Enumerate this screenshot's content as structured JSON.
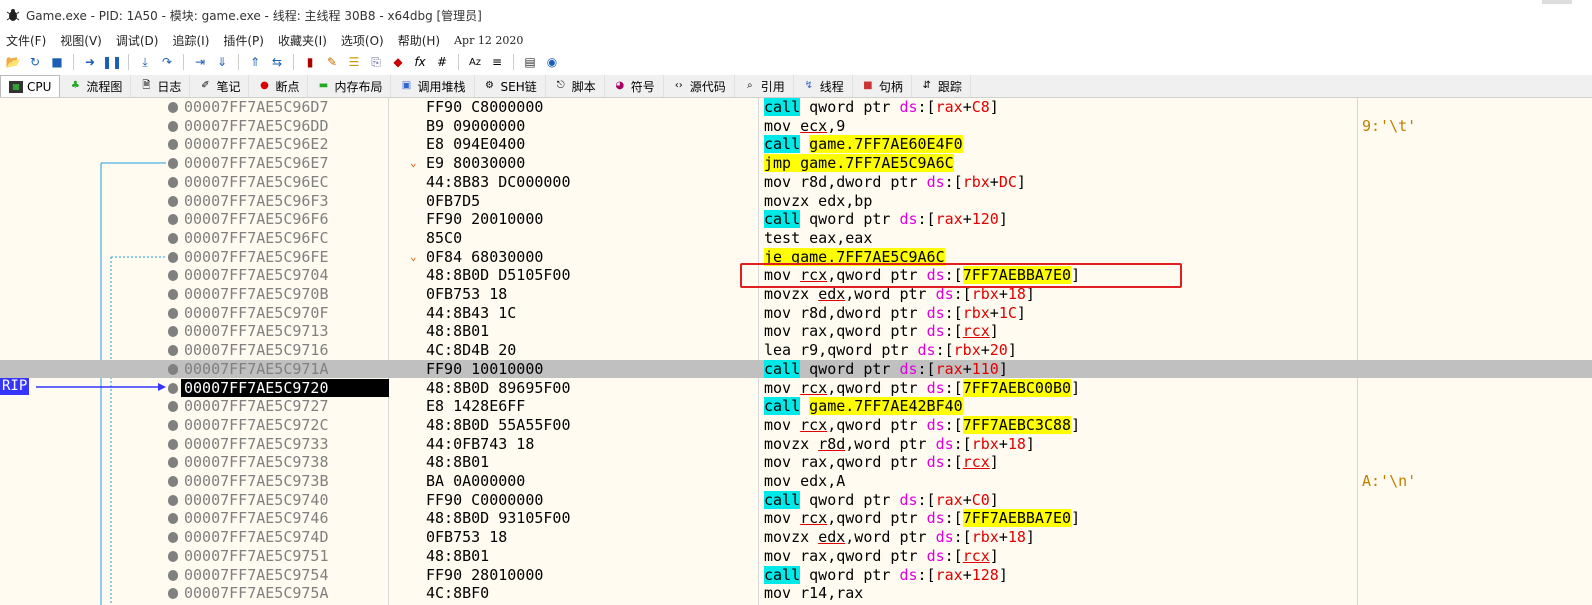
{
  "window": {
    "title": "Game.exe - PID: 1A50 - 模块: game.exe - 线程: 主线程 30B8 - x64dbg [管理员]"
  },
  "menu": {
    "items": [
      "文件(F)",
      "视图(V)",
      "调试(D)",
      "追踪(I)",
      "插件(P)",
      "收藏夹(I)",
      "选项(O)",
      "帮助(H)"
    ],
    "date": "Apr 12 2020"
  },
  "toolbar": {
    "icons": [
      "open-icon",
      "restart-icon",
      "stop-icon",
      "run-icon",
      "pause-icon",
      "step-into-icon",
      "step-over-icon",
      "trace-into-icon",
      "trace-over-icon",
      "execute-till-return-icon",
      "run-to-user-code-icon",
      "highlight-icon",
      "comment-icon",
      "label-icon",
      "bookmark-icon",
      "function-icon",
      "strings-icon",
      "patch-icon",
      "hash-icon",
      "font-icon",
      "calculator-icon",
      "about-icon"
    ],
    "fx_label": "fx",
    "hash_label": "#"
  },
  "tabs": [
    {
      "label": "CPU",
      "active": true,
      "icon": "cpu-icon"
    },
    {
      "label": "流程图",
      "icon": "graph-icon"
    },
    {
      "label": "日志",
      "icon": "log-icon"
    },
    {
      "label": "笔记",
      "icon": "notes-icon"
    },
    {
      "label": "断点",
      "icon": "breakpoint-icon"
    },
    {
      "label": "内存布局",
      "icon": "memory-icon"
    },
    {
      "label": "调用堆栈",
      "icon": "callstack-icon"
    },
    {
      "label": "SEH链",
      "icon": "seh-icon"
    },
    {
      "label": "脚本",
      "icon": "script-icon"
    },
    {
      "label": "符号",
      "icon": "symbol-icon"
    },
    {
      "label": "源代码",
      "icon": "source-icon"
    },
    {
      "label": "引用",
      "icon": "references-icon"
    },
    {
      "label": "线程",
      "icon": "threads-icon"
    },
    {
      "label": "句柄",
      "icon": "handles-icon"
    },
    {
      "label": "跟踪",
      "icon": "trace-icon"
    }
  ],
  "rip_label": "RIP",
  "rows": [
    {
      "addr": "00007FF7AE5C96D7",
      "bytes": "FF90 C8000000",
      "asm": [
        [
          "call",
          "call"
        ],
        [
          "t",
          " qword ptr "
        ],
        [
          "mag",
          "ds"
        ],
        [
          "t",
          ":["
        ],
        [
          "red",
          "rax"
        ],
        [
          "t",
          "+"
        ],
        [
          "red",
          "C8"
        ],
        [
          "t",
          "]"
        ]
      ],
      "cmt": ""
    },
    {
      "addr": "00007FF7AE5C96DD",
      "bytes": "B9 09000000",
      "asm": [
        [
          "t",
          "mov "
        ],
        [
          "reg",
          "ecx"
        ],
        [
          "t",
          ",9"
        ]
      ],
      "cmt": "9:'\\t'"
    },
    {
      "addr": "00007FF7AE5C96E2",
      "bytes": "E8 094E0400",
      "asm": [
        [
          "call",
          "call"
        ],
        [
          "t",
          " "
        ],
        [
          "yel",
          "game.7FF7AE60E4F0"
        ]
      ],
      "cmt": ""
    },
    {
      "addr": "00007FF7AE5C96E7",
      "bytes": "E9 80030000",
      "jarrow": true,
      "asm": [
        [
          "yel",
          "jmp game.7FF7AE5C9A6C"
        ]
      ],
      "cmt": ""
    },
    {
      "addr": "00007FF7AE5C96EC",
      "bytes": "44:8B83 DC000000",
      "asm": [
        [
          "t",
          "mov r8d,dword ptr "
        ],
        [
          "mag",
          "ds"
        ],
        [
          "t",
          ":["
        ],
        [
          "red",
          "rbx"
        ],
        [
          "t",
          "+"
        ],
        [
          "red",
          "DC"
        ],
        [
          "t",
          "]"
        ]
      ],
      "cmt": ""
    },
    {
      "addr": "00007FF7AE5C96F3",
      "bytes": "0FB7D5",
      "asm": [
        [
          "t",
          "movzx edx,bp"
        ]
      ],
      "cmt": ""
    },
    {
      "addr": "00007FF7AE5C96F6",
      "bytes": "FF90 20010000",
      "asm": [
        [
          "call",
          "call"
        ],
        [
          "t",
          " qword ptr "
        ],
        [
          "mag",
          "ds"
        ],
        [
          "t",
          ":["
        ],
        [
          "red",
          "rax"
        ],
        [
          "t",
          "+"
        ],
        [
          "red",
          "120"
        ],
        [
          "t",
          "]"
        ]
      ],
      "cmt": ""
    },
    {
      "addr": "00007FF7AE5C96FC",
      "bytes": "85C0",
      "asm": [
        [
          "t",
          "test eax,eax"
        ]
      ],
      "cmt": ""
    },
    {
      "addr": "00007FF7AE5C96FE",
      "bytes": "0F84 68030000",
      "jarrow": true,
      "asm": [
        [
          "yel",
          "je game.7FF7AE5C9A6C"
        ]
      ],
      "cmt": ""
    },
    {
      "addr": "00007FF7AE5C9704",
      "bytes": "48:8B0D D5105F00",
      "asm": [
        [
          "t",
          "mov "
        ],
        [
          "reg",
          "rcx"
        ],
        [
          "t",
          ",qword ptr "
        ],
        [
          "mag",
          "ds"
        ],
        [
          "t",
          ":["
        ],
        [
          "yel",
          "7FF7AEBBA7E0"
        ],
        [
          "t",
          "]"
        ]
      ],
      "cmt": ""
    },
    {
      "addr": "00007FF7AE5C970B",
      "bytes": "0FB753 18",
      "asm": [
        [
          "t",
          "movzx "
        ],
        [
          "reg",
          "edx"
        ],
        [
          "t",
          ",word ptr "
        ],
        [
          "mag",
          "ds"
        ],
        [
          "t",
          ":["
        ],
        [
          "red",
          "rbx"
        ],
        [
          "t",
          "+"
        ],
        [
          "red",
          "18"
        ],
        [
          "t",
          "]"
        ]
      ],
      "cmt": ""
    },
    {
      "addr": "00007FF7AE5C970F",
      "bytes": "44:8B43 1C",
      "asm": [
        [
          "t",
          "mov r8d,dword ptr "
        ],
        [
          "mag",
          "ds"
        ],
        [
          "t",
          ":["
        ],
        [
          "red",
          "rbx"
        ],
        [
          "t",
          "+"
        ],
        [
          "red",
          "1C"
        ],
        [
          "t",
          "]"
        ]
      ],
      "cmt": ""
    },
    {
      "addr": "00007FF7AE5C9713",
      "bytes": "48:8B01",
      "asm": [
        [
          "t",
          "mov rax,qword ptr "
        ],
        [
          "mag",
          "ds"
        ],
        [
          "t",
          ":["
        ],
        [
          "redu",
          "rcx"
        ],
        [
          "t",
          "]"
        ]
      ],
      "cmt": ""
    },
    {
      "addr": "00007FF7AE5C9716",
      "bytes": "4C:8D4B 20",
      "asm": [
        [
          "t",
          "lea r9,qword ptr "
        ],
        [
          "mag",
          "ds"
        ],
        [
          "t",
          ":["
        ],
        [
          "red",
          "rbx"
        ],
        [
          "t",
          "+"
        ],
        [
          "red",
          "20"
        ],
        [
          "t",
          "]"
        ]
      ],
      "cmt": ""
    },
    {
      "addr": "00007FF7AE5C971A",
      "bytes": "FF90 10010000",
      "sel": true,
      "asm": [
        [
          "call",
          "call"
        ],
        [
          "t",
          " qword ptr "
        ],
        [
          "mag",
          "ds"
        ],
        [
          "t",
          ":["
        ],
        [
          "red",
          "rax"
        ],
        [
          "t",
          "+"
        ],
        [
          "red",
          "110"
        ],
        [
          "t",
          "]"
        ]
      ],
      "cmt": ""
    },
    {
      "addr": "00007FF7AE5C9720",
      "bytes": "48:8B0D 89695F00",
      "cur": true,
      "asm": [
        [
          "t",
          "mov "
        ],
        [
          "reg",
          "rcx"
        ],
        [
          "t",
          ",qword ptr "
        ],
        [
          "mag",
          "ds"
        ],
        [
          "t",
          ":["
        ],
        [
          "yel",
          "7FF7AEBC00B0"
        ],
        [
          "t",
          "]"
        ]
      ],
      "cmt": ""
    },
    {
      "addr": "00007FF7AE5C9727",
      "bytes": "E8 1428E6FF",
      "asm": [
        [
          "call",
          "call"
        ],
        [
          "t",
          " "
        ],
        [
          "yel",
          "game.7FF7AE42BF40"
        ]
      ],
      "cmt": ""
    },
    {
      "addr": "00007FF7AE5C972C",
      "bytes": "48:8B0D 55A55F00",
      "asm": [
        [
          "t",
          "mov "
        ],
        [
          "reg",
          "rcx"
        ],
        [
          "t",
          ",qword ptr "
        ],
        [
          "mag",
          "ds"
        ],
        [
          "t",
          ":["
        ],
        [
          "yel",
          "7FF7AEBC3C88"
        ],
        [
          "t",
          "]"
        ]
      ],
      "cmt": ""
    },
    {
      "addr": "00007FF7AE5C9733",
      "bytes": "44:0FB743 18",
      "asm": [
        [
          "t",
          "movzx "
        ],
        [
          "reg",
          "r8d"
        ],
        [
          "t",
          ",word ptr "
        ],
        [
          "mag",
          "ds"
        ],
        [
          "t",
          ":["
        ],
        [
          "red",
          "rbx"
        ],
        [
          "t",
          "+"
        ],
        [
          "red",
          "18"
        ],
        [
          "t",
          "]"
        ]
      ],
      "cmt": ""
    },
    {
      "addr": "00007FF7AE5C9738",
      "bytes": "48:8B01",
      "asm": [
        [
          "t",
          "mov rax,qword ptr "
        ],
        [
          "mag",
          "ds"
        ],
        [
          "t",
          ":["
        ],
        [
          "redu",
          "rcx"
        ],
        [
          "t",
          "]"
        ]
      ],
      "cmt": ""
    },
    {
      "addr": "00007FF7AE5C973B",
      "bytes": "BA 0A000000",
      "asm": [
        [
          "t",
          "mov edx,A"
        ]
      ],
      "cmt": "A:'\\n'"
    },
    {
      "addr": "00007FF7AE5C9740",
      "bytes": "FF90 C0000000",
      "asm": [
        [
          "call",
          "call"
        ],
        [
          "t",
          " qword ptr "
        ],
        [
          "mag",
          "ds"
        ],
        [
          "t",
          ":["
        ],
        [
          "red",
          "rax"
        ],
        [
          "t",
          "+"
        ],
        [
          "red",
          "C0"
        ],
        [
          "t",
          "]"
        ]
      ],
      "cmt": ""
    },
    {
      "addr": "00007FF7AE5C9746",
      "bytes": "48:8B0D 93105F00",
      "asm": [
        [
          "t",
          "mov "
        ],
        [
          "reg",
          "rcx"
        ],
        [
          "t",
          ",qword ptr "
        ],
        [
          "mag",
          "ds"
        ],
        [
          "t",
          ":["
        ],
        [
          "yel",
          "7FF7AEBBA7E0"
        ],
        [
          "t",
          "]"
        ]
      ],
      "cmt": ""
    },
    {
      "addr": "00007FF7AE5C974D",
      "bytes": "0FB753 18",
      "asm": [
        [
          "t",
          "movzx "
        ],
        [
          "reg",
          "edx"
        ],
        [
          "t",
          ",word ptr "
        ],
        [
          "mag",
          "ds"
        ],
        [
          "t",
          ":["
        ],
        [
          "red",
          "rbx"
        ],
        [
          "t",
          "+"
        ],
        [
          "red",
          "18"
        ],
        [
          "t",
          "]"
        ]
      ],
      "cmt": ""
    },
    {
      "addr": "00007FF7AE5C9751",
      "bytes": "48:8B01",
      "asm": [
        [
          "t",
          "mov rax,qword ptr "
        ],
        [
          "mag",
          "ds"
        ],
        [
          "t",
          ":["
        ],
        [
          "redu",
          "rcx"
        ],
        [
          "t",
          "]"
        ]
      ],
      "cmt": ""
    },
    {
      "addr": "00007FF7AE5C9754",
      "bytes": "FF90 28010000",
      "asm": [
        [
          "call",
          "call"
        ],
        [
          "t",
          " qword ptr "
        ],
        [
          "mag",
          "ds"
        ],
        [
          "t",
          ":["
        ],
        [
          "red",
          "rax"
        ],
        [
          "t",
          "+"
        ],
        [
          "red",
          "128"
        ],
        [
          "t",
          "]"
        ]
      ],
      "cmt": ""
    },
    {
      "addr": "00007FF7AE5C975A",
      "bytes": "4C:8BF0",
      "asm": [
        [
          "t",
          "mov r14,rax"
        ]
      ],
      "cmt": ""
    }
  ]
}
